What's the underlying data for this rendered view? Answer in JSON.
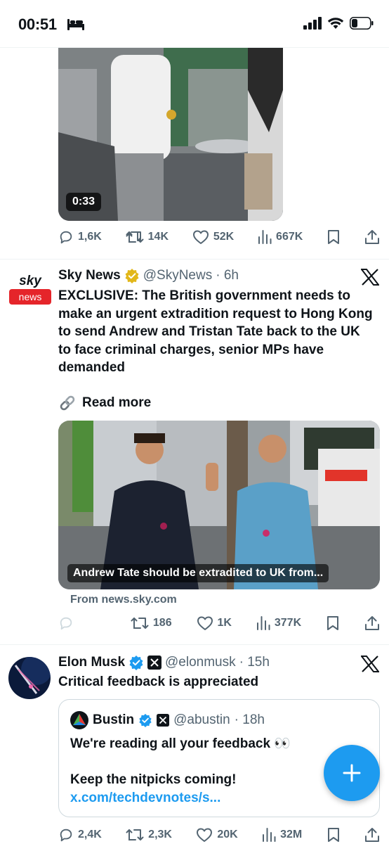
{
  "status_bar": {
    "time": "00:51"
  },
  "tweets": [
    {
      "video": {
        "duration": "0:33"
      },
      "actions": {
        "replies": "1,6K",
        "retweets": "14K",
        "likes": "52K",
        "views": "667K"
      }
    },
    {
      "author": {
        "name": "Sky News",
        "handle": "@SkyNews",
        "time": "· 6h",
        "avatar_top": "sky",
        "avatar_bottom": "news"
      },
      "text": "EXCLUSIVE: The British government needs to make an urgent extradition request to Hong Kong to send Andrew and Tristan Tate back to the UK to face criminal charges, senior MPs have demanded",
      "read_more": "Read more",
      "card": {
        "caption": "Andrew Tate should be extradited to UK from...",
        "source": "From news.sky.com"
      },
      "actions": {
        "replies": "",
        "retweets": "186",
        "likes": "1K",
        "views": "377K"
      }
    },
    {
      "author": {
        "name": "Elon Musk",
        "handle": "@elonmusk",
        "time": "· 15h"
      },
      "text": "Critical feedback is appreciated",
      "quote": {
        "name": "Bustin",
        "handle": "@abustin",
        "time": "· 18h",
        "line1": "We're reading all your feedback 👀",
        "line2": "Keep the nitpicks coming! ",
        "link": "x.com/techdevnotes/s..."
      },
      "actions": {
        "replies": "2,4K",
        "retweets": "2,3K",
        "likes": "20K",
        "views": "32M"
      }
    }
  ],
  "colors": {
    "accent": "#1d9bf0",
    "muted": "#536471",
    "verified_gold": "#e2b719",
    "verified_blue": "#1d9bf0"
  }
}
